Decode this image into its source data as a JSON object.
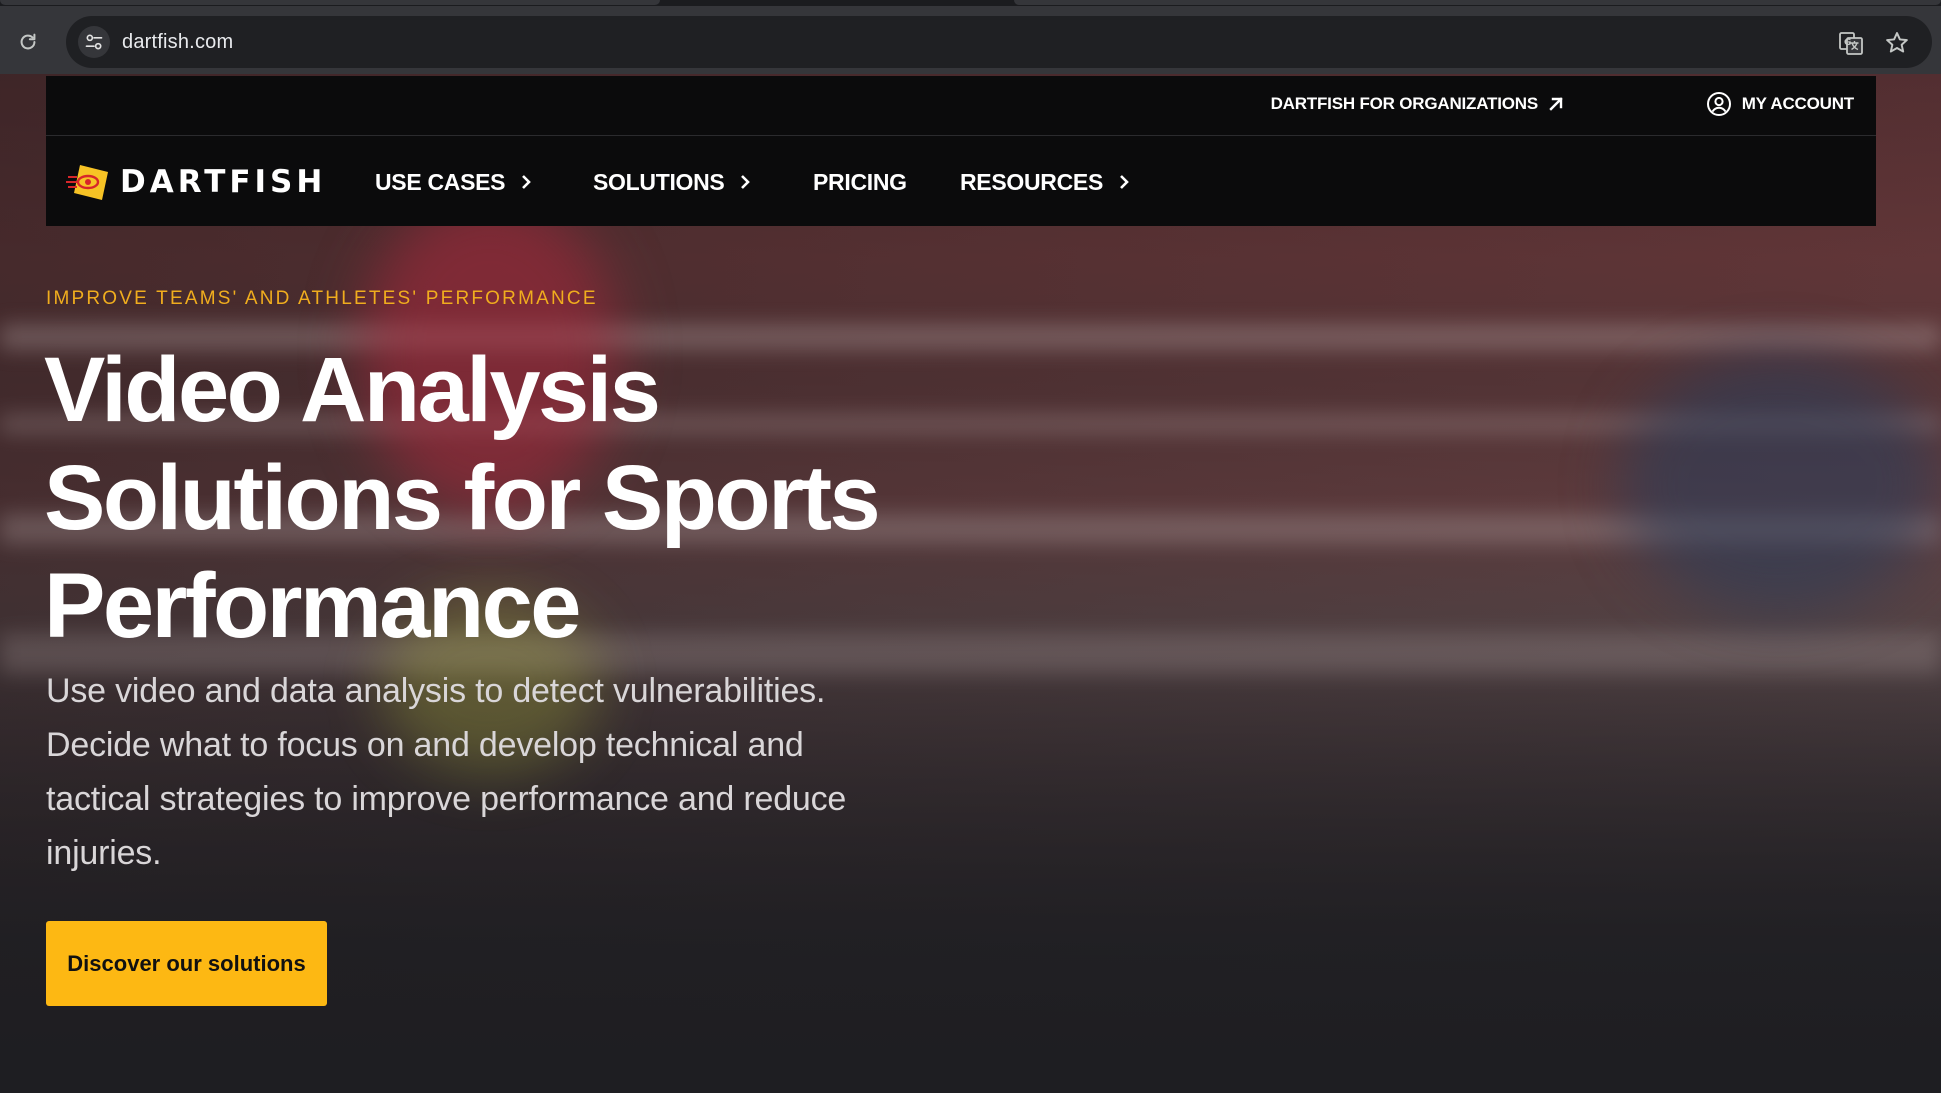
{
  "browser": {
    "url": "dartfish.com",
    "icons": {
      "reload": "reload-icon",
      "site_info": "tune-icon",
      "translate": "translate-icon",
      "bookmark": "star-icon"
    }
  },
  "header": {
    "utility": {
      "organizations_label": "DARTFISH FOR ORGANIZATIONS",
      "account_label": "MY ACCOUNT"
    },
    "logo_text": "DARTFISH",
    "nav": [
      {
        "label": "USE CASES",
        "has_submenu": true
      },
      {
        "label": "SOLUTIONS",
        "has_submenu": true
      },
      {
        "label": "PRICING",
        "has_submenu": false
      },
      {
        "label": "RESOURCES",
        "has_submenu": true
      }
    ]
  },
  "hero": {
    "eyebrow": "IMPROVE TEAMS' AND ATHLETES' PERFORMANCE",
    "title_lines": [
      "Video Analysis",
      "Solutions for Sports",
      "Performance"
    ],
    "subtitle": "Use video and data analysis to detect vulnerabilities. Decide what to focus on and develop technical and tactical strategies to improve performance and reduce injuries.",
    "cta_label": "Discover our solutions"
  },
  "colors": {
    "accent": "#fdb813",
    "eyebrow": "#f0ad1e",
    "header_bg": "#0b0b0c",
    "logo_yellow": "#f7c325",
    "logo_red": "#d7262a"
  }
}
